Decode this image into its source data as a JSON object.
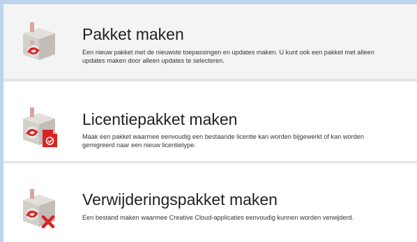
{
  "colors": {
    "window_background": "#bcd4ec",
    "selected_row": "#f4f4f4",
    "adobe_red": "#d92323"
  },
  "options": [
    {
      "title": "Pakket maken",
      "description": "Een nieuw pakket met de nieuwste toepassingen en updates maken. U kunt ook een pakket met alleen updates maken door alleen updates te selecteren.",
      "icon": "package-box-icon",
      "selected": true
    },
    {
      "title": "Licentiepakket maken",
      "description": "Maak een pakket waarmee eenvoudig een bestaande licentie kan worden bijgewerkt of kan worden gemigreerd naar een nieuw licentietype.",
      "icon": "license-package-icon",
      "selected": false
    },
    {
      "title": "Verwijderingspakket maken",
      "description": "Een bestand maken waarmee Creative Cloud-applicaties eenvoudig kunnen worden verwijderd.",
      "icon": "uninstall-package-icon",
      "selected": false
    }
  ]
}
